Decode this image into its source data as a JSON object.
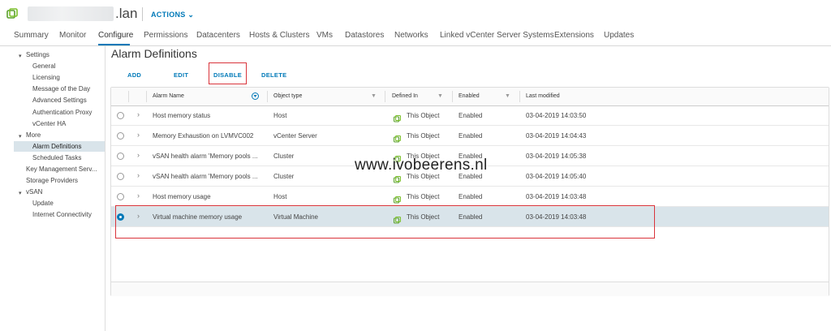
{
  "header": {
    "host_suffix": ".lan",
    "actions_label": "ACTIONS ⌄"
  },
  "tabs": [
    "Summary",
    "Monitor",
    "Configure",
    "Permissions",
    "Datacenters",
    "Hosts & Clusters",
    "VMs",
    "Datastores",
    "Networks",
    "Linked vCenter Server Systems",
    "Extensions",
    "Updates"
  ],
  "active_tab": "Configure",
  "sidebar": {
    "settings": "Settings",
    "general": "General",
    "licensing": "Licensing",
    "message_of_the_day": "Message of the Day",
    "advanced_settings": "Advanced Settings",
    "authentication_proxy": "Authentication Proxy",
    "vcenter_ha": "vCenter HA",
    "more": "More",
    "alarm_definitions": "Alarm Definitions",
    "scheduled_tasks": "Scheduled Tasks",
    "key_management": "Key Management Serv...",
    "storage_providers": "Storage Providers",
    "vsan": "vSAN",
    "update": "Update",
    "internet_connectivity": "Internet Connectivity"
  },
  "main": {
    "title": "Alarm Definitions",
    "buttons": {
      "add": "ADD",
      "edit": "EDIT",
      "disable": "DISABLE",
      "delete": "DELETE"
    },
    "columns": {
      "name": "Alarm Name",
      "type": "Object type",
      "defined": "Defined In",
      "enabled": "Enabled",
      "modified": "Last modified"
    },
    "rows": [
      {
        "name": "Host memory status",
        "type": "Host",
        "defined": "This Object",
        "enabled": "Enabled",
        "modified": "03-04-2019 14:03:50"
      },
      {
        "name": "Memory Exhaustion on LVMVC002",
        "type": "vCenter Server",
        "defined": "This Object",
        "enabled": "Enabled",
        "modified": "03-04-2019 14:04:43"
      },
      {
        "name": "vSAN health alarm 'Memory pools ...",
        "type": "Cluster",
        "defined": "This Object",
        "enabled": "Enabled",
        "modified": "03-04-2019 14:05:38"
      },
      {
        "name": "vSAN health alarm 'Memory pools ...",
        "type": "Cluster",
        "defined": "This Object",
        "enabled": "Enabled",
        "modified": "03-04-2019 14:05:40"
      },
      {
        "name": "Host memory usage",
        "type": "Host",
        "defined": "This Object",
        "enabled": "Enabled",
        "modified": "03-04-2019 14:03:48"
      },
      {
        "name": "Virtual machine memory usage",
        "type": "Virtual Machine",
        "defined": "This Object",
        "enabled": "Enabled",
        "modified": "03-04-2019 14:03:48"
      }
    ],
    "selected_row": 5
  },
  "watermark": "www.ivobeerens.nl",
  "colors": {
    "accent": "#0079b8",
    "selection": "#d9e4ea",
    "highlight_box": "#d9343b",
    "object_icon": "#7bbf2a"
  }
}
